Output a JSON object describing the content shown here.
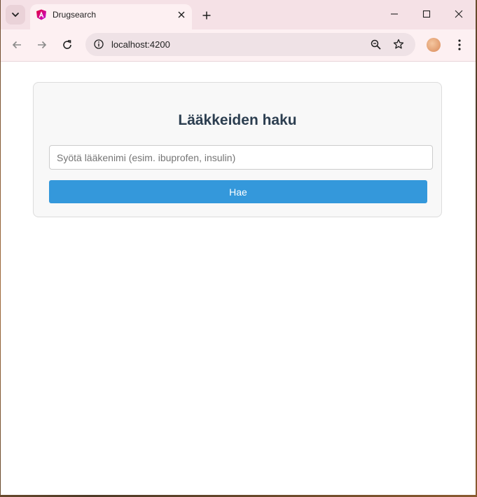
{
  "browser": {
    "tab": {
      "title": "Drugsearch",
      "favicon": "angular-icon"
    },
    "address": {
      "url": "localhost:4200"
    },
    "icons": {
      "tab_menu": "chevron-down-icon",
      "close_tab": "close-icon",
      "new_tab": "plus-icon",
      "minimize": "minimize-icon",
      "maximize": "maximize-icon",
      "close_window": "close-icon",
      "back": "back-arrow-icon",
      "forward": "forward-arrow-icon",
      "reload": "reload-icon",
      "site_info": "info-icon",
      "zoom": "zoom-icon",
      "bookmark": "star-icon",
      "profile": "avatar",
      "menu": "kebab-menu-icon"
    }
  },
  "page": {
    "title": "Lääkkeiden haku",
    "search": {
      "placeholder": "Syötä lääkenimi (esim. ibuprofen, insulin)",
      "value": ""
    },
    "button_label": "Hae",
    "colors": {
      "accent": "#3498db",
      "title": "#2c3e50",
      "card_bg": "#f8f8f8"
    }
  }
}
